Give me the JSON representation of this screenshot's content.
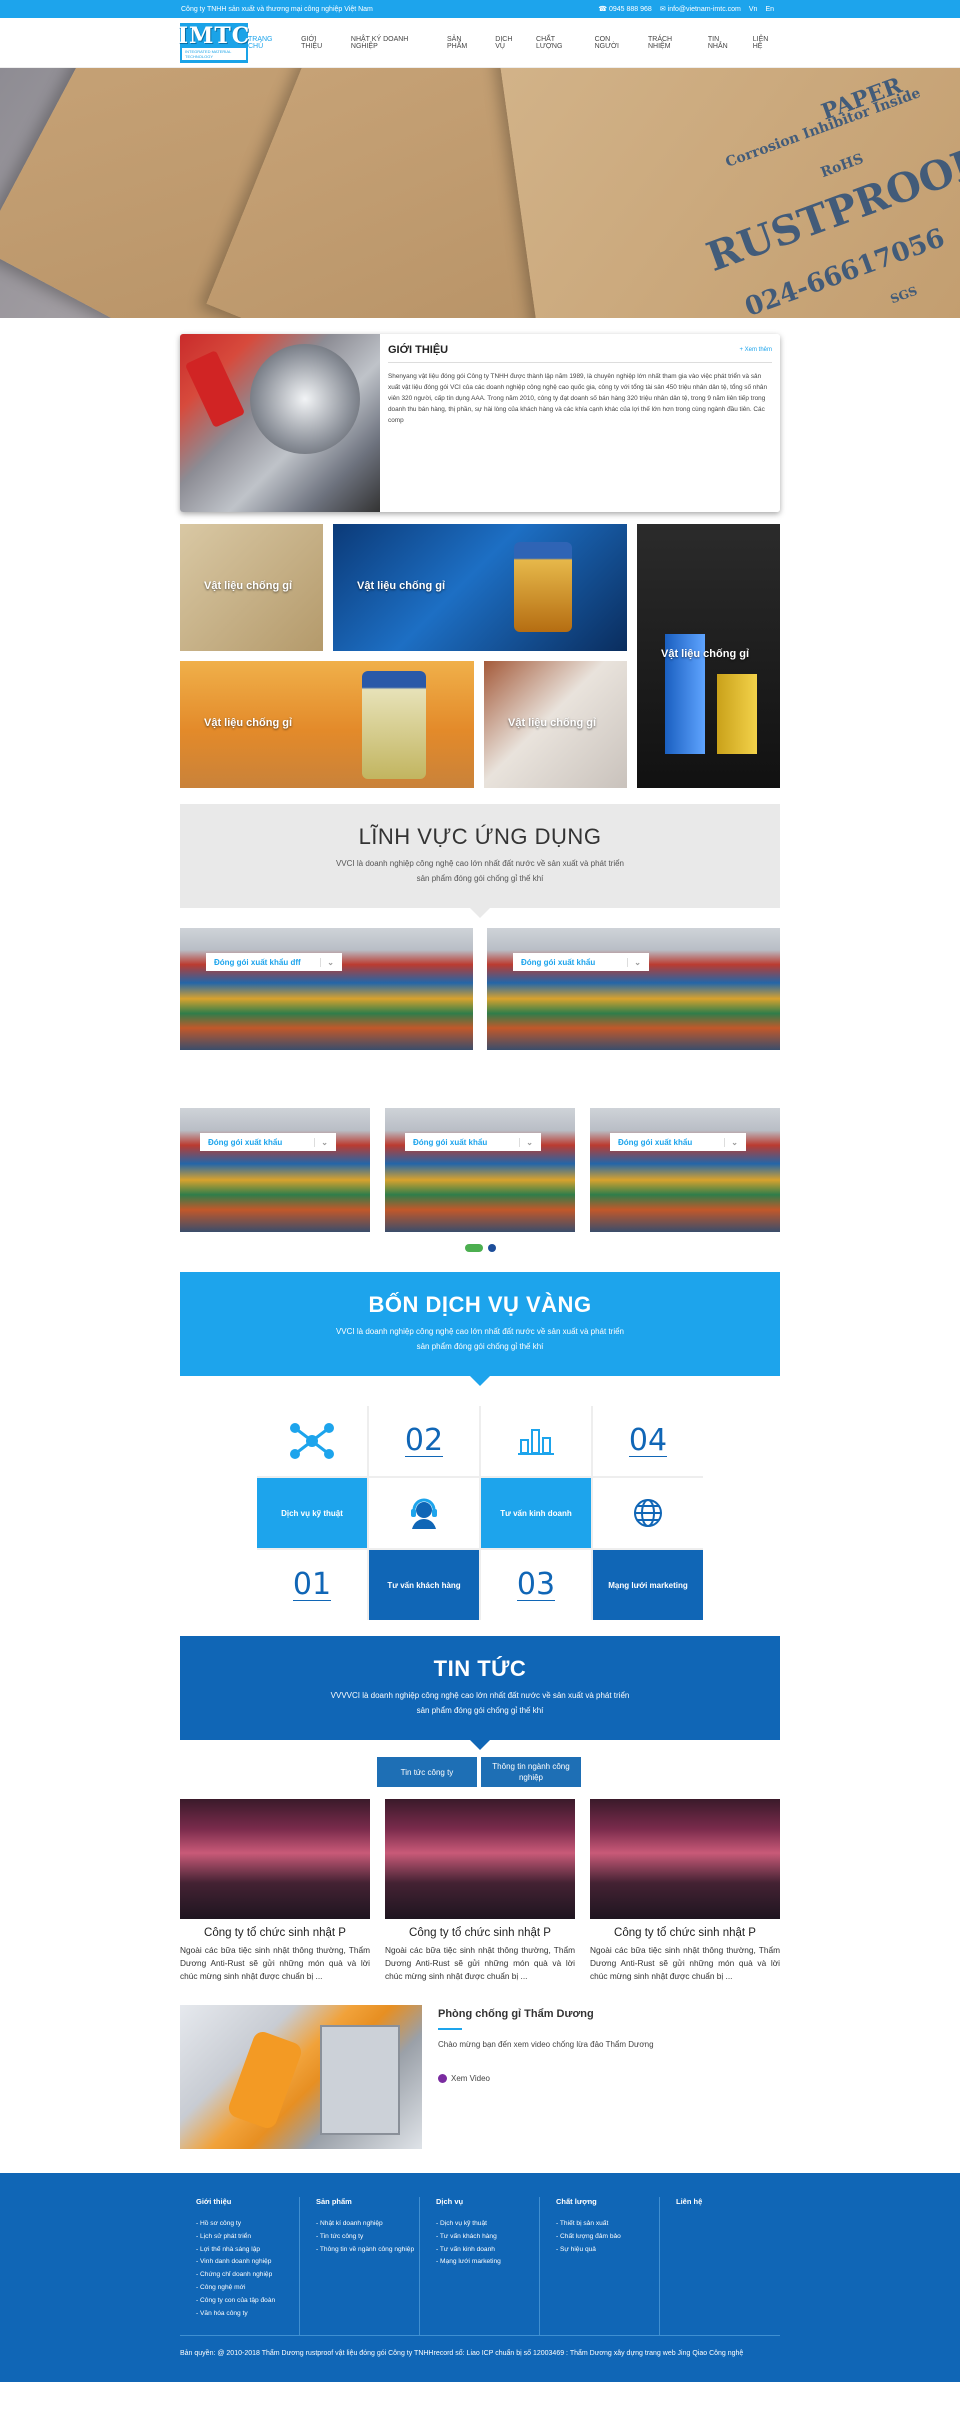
{
  "topbar": {
    "company": "Công ty TNHH sản xuất và thương mại công nghiệp Việt Nam",
    "phone": "0945 888 968",
    "email": "info@vietnam-imtc.com",
    "lang_vn": "Vn",
    "lang_en": "En"
  },
  "logo": {
    "text": "IMTC",
    "tag": "INTEGRATED MATERIAL TECHNOLOGY"
  },
  "nav": [
    "TRANG CHỦ",
    "GIỚI THIỆU",
    "NHẬT KÝ DOANH NGHIỆP",
    "SẢN PHẨM",
    "DỊCH VỤ",
    "CHẤT LƯỢNG",
    "CON NGƯỜI",
    "TRÁCH NHIỆM",
    "TIN NHẮN",
    "LIÊN HỆ"
  ],
  "hero": {
    "line1": "PAPER",
    "line2": "Corrosion Inhibitor Inside",
    "line3": "RUSTPROOF",
    "line4": "024-66617056",
    "line5": "RoHS",
    "line6": "SGS"
  },
  "intro": {
    "title": "GIỚI THIỆU",
    "more": "+ Xem thêm",
    "text": "Shenyang vật liệu đóng gói Công ty TNHH được thành lập năm 1989, là chuyên nghiệp lớn nhất tham gia vào việc phát triển và sản xuất vật liệu đóng gói VCI của các doanh nghiệp công nghệ cao quốc gia, công ty với tổng tài sản 450 triệu nhân dân tệ, tổng số nhân viên 320 người, cấp tín dụng AAA. Trong năm 2010, công ty đạt doanh số bán hàng 320 triệu nhân dân tệ, trong 9 năm liên tiếp trong doanh thu bán hàng, thị phần, sự hài lòng của khách hàng và các khía cạnh khác của lợi thế lớn hơn trong cùng ngành đầu tiên. Các comp"
  },
  "tiles": [
    "Vật liệu chống gỉ",
    "Vật liệu chống gỉ",
    "Vật liệu chống gỉ",
    "Vật liệu chống gỉ",
    "Vật liệu chống gỉ"
  ],
  "field": {
    "title": "LĨNH VỰC ỨNG DỤNG",
    "desc": "VVCI là doanh nghiệp công nghệ cao lớn nhất đất nước về sản xuất và phát triển sản phẩm đóng gói chống gỉ thế khí",
    "items": [
      "Đóng gói xuất khẩu dff",
      "Đóng gói xuất khẩu",
      "Đóng gói xuất khẩu",
      "Đóng gói xuất khẩu",
      "Đóng gói xuất khẩu"
    ]
  },
  "services": {
    "title": "BỐN DỊCH VỤ VÀNG",
    "desc": "VVCI là doanh nghiệp công nghệ cao lớn nhất đất nước về sản xuất và phát triển sản phẩm đóng gói chống gỉ thế khí",
    "n1": "01",
    "n2": "02",
    "n3": "03",
    "n4": "04",
    "s1": "Dịch vụ kỹ thuật",
    "s2": "Tư vấn khách hàng",
    "s3": "Tư vấn kinh doanh",
    "s4": "Mạng lưới marketing"
  },
  "news": {
    "title": "TIN TỨC",
    "desc": "VVVVCI là doanh nghiệp công nghệ cao lớn nhất đất nước về sản xuất và phát triển sản phẩm đóng gói chống gỉ thế khí",
    "tab1": "Tin tức công ty",
    "tab2": "Thông tin ngành công nghiệp",
    "cards": [
      {
        "title": "Công ty tổ chức sinh nhật P",
        "text": "Ngoài các bữa tiệc sinh nhật thông thường, Thẩm Dương Anti-Rust sẽ gửi những món quà và lời chúc mừng sinh nhật được chuẩn bị ..."
      },
      {
        "title": "Công ty tổ chức sinh nhật P",
        "text": "Ngoài các bữa tiệc sinh nhật thông thường, Thẩm Dương Anti-Rust sẽ gửi những món quà và lời chúc mừng sinh nhật được chuẩn bị ..."
      },
      {
        "title": "Công ty tổ chức sinh nhật P",
        "text": "Ngoài các bữa tiệc sinh nhật thông thường, Thẩm Dương Anti-Rust sẽ gửi những món quà và lời chúc mừng sinh nhật được chuẩn bị ..."
      }
    ],
    "video_title": "Phòng chống gỉ Thẩm Dương",
    "video_text": "Chào mừng bạn đến xem video chống lừa đảo Thẩm Dương",
    "video_link": "Xem Video"
  },
  "footer": {
    "c1": {
      "title": "Giới thiệu",
      "items": [
        "- Hồ sơ công ty",
        "- Lịch sử phát triển",
        "- Lợi thế nhà sáng lập",
        "- Vinh danh doanh nghiệp",
        "- Chứng chỉ doanh nghiệp",
        "- Công nghệ mới",
        "- Công ty con của tập đoàn",
        "- Văn hóa công ty"
      ]
    },
    "c2": {
      "title": "Sản phẩm",
      "items": [
        "- Nhật kí doanh nghiệp",
        "- Tin tức công ty",
        "- Thông tin về ngành công nghiệp"
      ]
    },
    "c3": {
      "title": "Dịch vụ",
      "items": [
        "- Dịch vụ kỹ thuật",
        "- Tư vấn khách hàng",
        "- Tư vấn kinh doanh",
        "- Mạng lưới marketing"
      ]
    },
    "c4": {
      "title": "Chất lượng",
      "items": [
        "- Thiết bị sản xuất",
        "- Chất lượng đảm bảo",
        "- Sự hiệu quả"
      ]
    },
    "c5": {
      "title": "Liên hệ",
      "items": []
    },
    "copyright": "Bản quyền: @ 2010-2018 Thẩm Dương rustproof vật liệu đóng gói Công ty TNHHrecord số: Liao ICP chuẩn bị số 12003469 : Thẩm Dương xây dựng trang web Jing Qiao Công nghệ"
  }
}
